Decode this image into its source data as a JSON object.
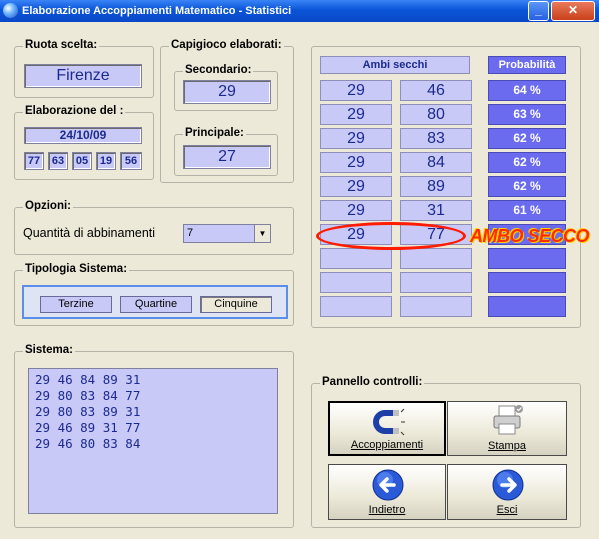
{
  "window": {
    "title": "Elaborazione Accoppiamenti Matematico - Statistici"
  },
  "ruota": {
    "legend": "Ruota scelta:",
    "value": "Firenze"
  },
  "capigioco": {
    "legend": "Capigioco elaborati:",
    "secondario_label": "Secondario:",
    "secondario_value": "29",
    "principale_label": "Principale:",
    "principale_value": "27"
  },
  "elaborazione": {
    "legend": "Elaborazione del :",
    "date": "24/10/09",
    "numbers": [
      "77",
      "63",
      "05",
      "19",
      "56"
    ]
  },
  "opzioni": {
    "legend": "Opzioni:",
    "label": "Quantità di abbinamenti",
    "selected": "7"
  },
  "tipologia": {
    "legend": "Tipologia Sistema:",
    "buttons": [
      "Terzine",
      "Quartine",
      "Cinquine"
    ]
  },
  "ambi": {
    "header": "Ambi secchi",
    "prob_header": "Probabilità",
    "rows": [
      {
        "a": "29",
        "b": "46",
        "p": "64 %"
      },
      {
        "a": "29",
        "b": "80",
        "p": "63 %"
      },
      {
        "a": "29",
        "b": "83",
        "p": "62 %"
      },
      {
        "a": "29",
        "b": "84",
        "p": "62 %"
      },
      {
        "a": "29",
        "b": "89",
        "p": "62 %"
      },
      {
        "a": "29",
        "b": "31",
        "p": "61 %"
      },
      {
        "a": "29",
        "b": "77",
        "p": ""
      },
      {
        "a": "",
        "b": "",
        "p": ""
      },
      {
        "a": "",
        "b": "",
        "p": ""
      },
      {
        "a": "",
        "b": "",
        "p": ""
      }
    ],
    "annotation": "AMBO SECCO",
    "annotation_color": "#ff2a00"
  },
  "sistema": {
    "legend": "Sistema:",
    "lines": [
      "29 46 84 89 31",
      "29 80 83 84 77",
      "29 80 83 89 31",
      "29 46 89 31 77",
      "29 46 80 83 84"
    ]
  },
  "controlli": {
    "legend": "Pannello controlli:",
    "accoppiamenti": "Accoppiamenti",
    "stampa": "Stampa",
    "indietro": "Indietro",
    "esci": "Esci"
  }
}
